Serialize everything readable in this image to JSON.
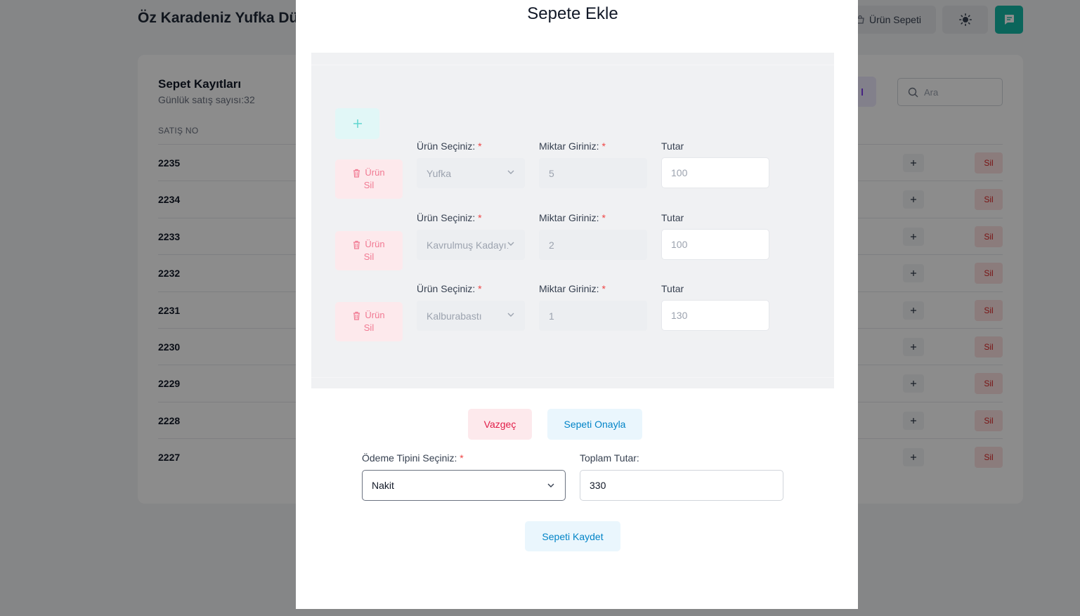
{
  "app": {
    "title": "Öz Karadeniz Yufka Dükkanı"
  },
  "topbar": {
    "basket_label": "Ürün Sepeti",
    "theme_icon": "sun-icon",
    "chat_icon": "chat-icon",
    "accent": "#14b8a6"
  },
  "records": {
    "title": "Sepet Kayıtları",
    "subtitle": "Günlük satış sayısı:32",
    "search_placeholder": "Ara",
    "column_header": "SATIŞ NO",
    "delete_label": "Sil",
    "rows": [
      {
        "no": "2235"
      },
      {
        "no": "2234"
      },
      {
        "no": "2233"
      },
      {
        "no": "2232"
      },
      {
        "no": "2231"
      },
      {
        "no": "2230"
      },
      {
        "no": "2229"
      },
      {
        "no": "2228"
      },
      {
        "no": "2227"
      }
    ]
  },
  "modal": {
    "title": "Sepete Ekle",
    "add_icon": "plus-icon",
    "labels": {
      "product": "Ürün Seçiniz:",
      "quantity": "Miktar Giriniz:",
      "total": "Tutar",
      "required_mark": "*"
    },
    "delete_item": {
      "line1": "Ürün",
      "line2": "Sil"
    },
    "items": [
      {
        "product": "Yufka",
        "quantity": "5",
        "total": "100"
      },
      {
        "product": "Kavrulmuş Kadayıf",
        "quantity": "2",
        "total": "100"
      },
      {
        "product": "Kalburabastı",
        "quantity": "1",
        "total": "130"
      }
    ],
    "cancel_label": "Vazgeç",
    "confirm_label": "Sepeti Onayla",
    "payment": {
      "label": "Ödeme Tipini Seçiniz:",
      "required_mark": "*",
      "value": "Nakit"
    },
    "grand_total": {
      "label": "Toplam Tutar:",
      "value": "330"
    },
    "save_label": "Sepeti Kaydet"
  }
}
